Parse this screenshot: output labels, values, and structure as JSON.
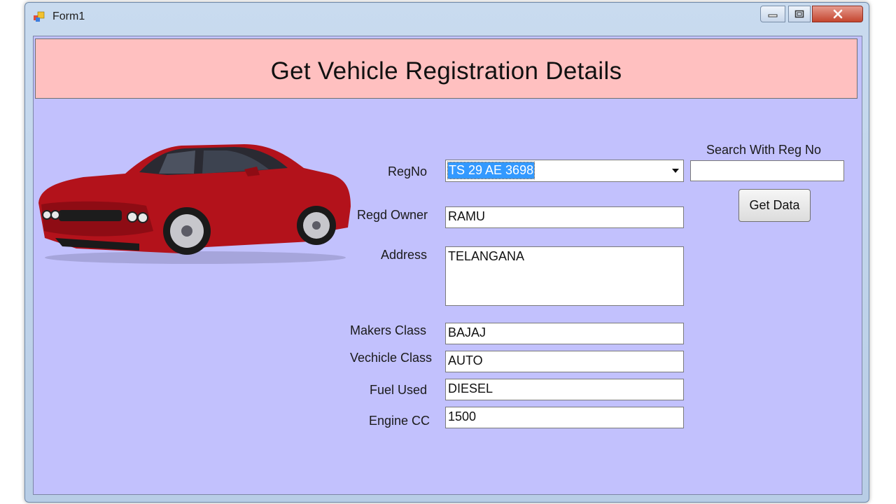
{
  "window": {
    "title": "Form1"
  },
  "header": {
    "title": "Get Vehicle Registration Details"
  },
  "form": {
    "regno_label": "RegNo",
    "regno_value": "TS 29 AE 3698",
    "owner_label": "Regd Owner",
    "owner_value": "RAMU",
    "address_label": "Address",
    "address_value": "TELANGANA",
    "makers_label": "Makers Class",
    "makers_value": "BAJAJ",
    "vclass_label": "Vechicle Class",
    "vclass_value": "AUTO",
    "fuel_label": "Fuel Used",
    "fuel_value": "DIESEL",
    "engine_label": "Engine CC",
    "engine_value": "1500"
  },
  "search": {
    "label": "Search With Reg No",
    "value": "",
    "button_label": "Get Data"
  },
  "colors": {
    "client_bg": "#c2c1fd",
    "header_bg": "#ffc0c0",
    "selection": "#3399ff",
    "car_body": "#b3121b"
  },
  "icons": {
    "minimize": "minimize-icon",
    "maximize": "maximize-icon",
    "close": "close-icon",
    "app": "form-app-icon"
  }
}
